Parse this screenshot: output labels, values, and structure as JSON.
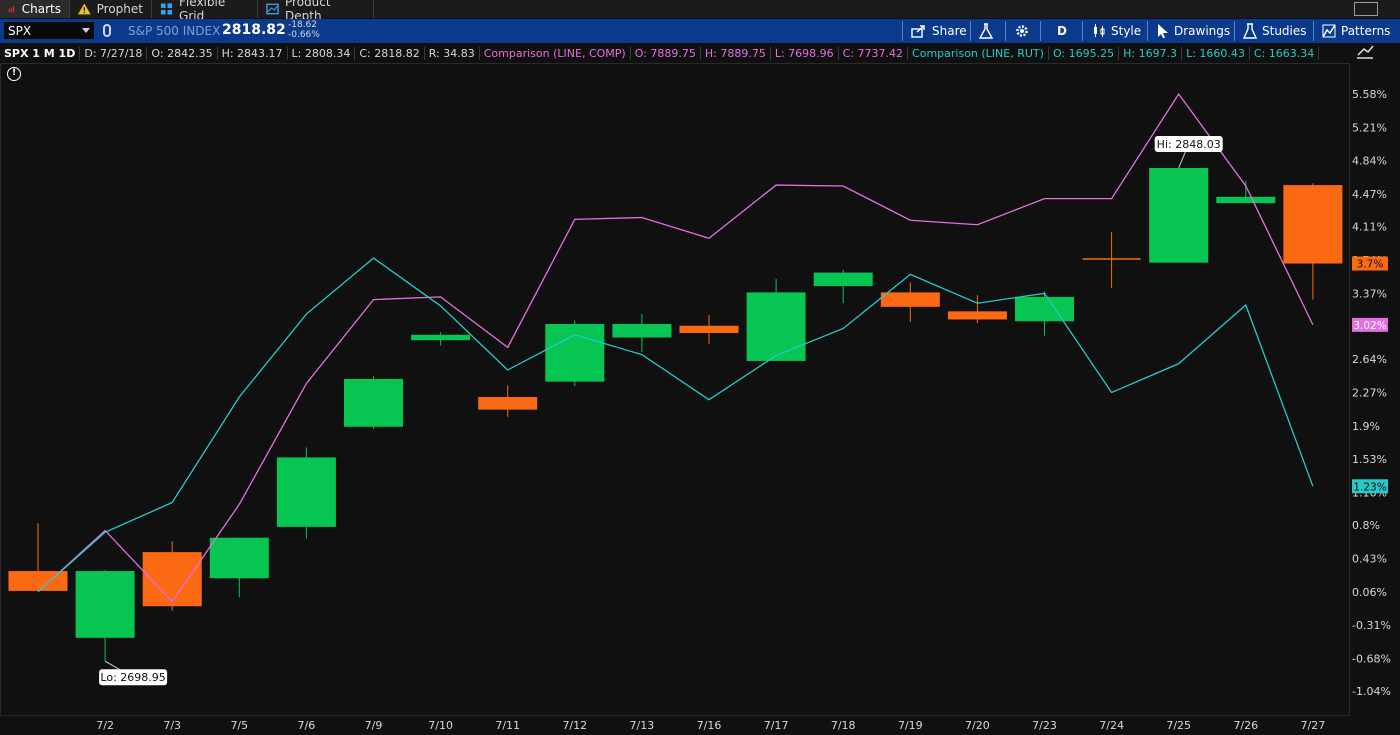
{
  "tabs": [
    {
      "label": "Charts",
      "icon": "bar-chart-icon"
    },
    {
      "label": "Prophet",
      "icon": "warning-triangle-icon"
    },
    {
      "label": "Flexible Grid",
      "icon": "grid-icon"
    },
    {
      "label": "Product Depth",
      "icon": "depth-chart-icon"
    }
  ],
  "symbol": {
    "ticker": "SPX",
    "name": "S&P 500 INDEX",
    "price": "2818.82",
    "change": "-18.62",
    "change_pct": "-0.66%"
  },
  "toolbar": {
    "share": "Share",
    "aggregation": "D",
    "style": "Style",
    "drawings": "Drawings",
    "studies": "Studies",
    "patterns": "Patterns"
  },
  "infobar": {
    "title": "SPX 1 M 1D",
    "date": "D: 7/27/18",
    "open": "O: 2842.35",
    "high": "H: 2843.17",
    "low": "L: 2808.34",
    "close": "C: 2818.82",
    "range": "R: 34.83",
    "comp_label": "Comparison (LINE, COMP)",
    "comp_open": "O: 7889.75",
    "comp_high": "H: 7889.75",
    "comp_low": "L: 7698.96",
    "comp_close": "C: 7737.42",
    "rut_label": "Comparison (LINE, RUT)",
    "rut_open": "O: 1695.25",
    "rut_high": "H: 1697.3",
    "rut_low": "L: 1660.43",
    "rut_close": "C: 1663.34"
  },
  "chart_data": {
    "type": "candlestick",
    "x_labels": [
      "7/2",
      "7/3",
      "7/5",
      "7/6",
      "7/9",
      "7/10",
      "7/11",
      "7/12",
      "7/13",
      "7/16",
      "7/17",
      "7/18",
      "7/19",
      "7/20",
      "7/23",
      "7/24",
      "7/25",
      "7/26",
      "7/27"
    ],
    "y_axis_percent": [
      "5.58%",
      "5.21%",
      "4.84%",
      "4.47%",
      "4.11%",
      "3.74%",
      "3.37%",
      "3.0%",
      "2.64%",
      "2.27%",
      "1.9%",
      "1.53%",
      "1.16%",
      "0.8%",
      "0.43%",
      "0.06%",
      "-0.31%",
      "-0.68%",
      "-1.04%"
    ],
    "y_range_percent": [
      -1.04,
      5.58
    ],
    "candles_percent": [
      {
        "o": 0.29,
        "h": 0.82,
        "l": 0.07,
        "c": 0.07,
        "up": false
      },
      {
        "o": -0.45,
        "h": 0.3,
        "l": -0.71,
        "c": 0.29,
        "up": true
      },
      {
        "o": 0.5,
        "h": 0.62,
        "l": -0.15,
        "c": -0.1,
        "up": false
      },
      {
        "o": 0.21,
        "h": 0.66,
        "l": 0.0,
        "c": 0.66,
        "up": true
      },
      {
        "o": 0.78,
        "h": 1.66,
        "l": 0.65,
        "c": 1.55,
        "up": true
      },
      {
        "o": 1.89,
        "h": 2.45,
        "l": 1.87,
        "c": 2.42,
        "up": true
      },
      {
        "o": 2.85,
        "h": 2.94,
        "l": 2.79,
        "c": 2.91,
        "up": true
      },
      {
        "o": 2.22,
        "h": 2.35,
        "l": 2.0,
        "c": 2.08,
        "up": false
      },
      {
        "o": 2.39,
        "h": 3.07,
        "l": 2.34,
        "c": 3.03,
        "up": true
      },
      {
        "o": 2.88,
        "h": 3.14,
        "l": 2.72,
        "c": 3.03,
        "up": true
      },
      {
        "o": 3.01,
        "h": 3.13,
        "l": 2.81,
        "c": 2.93,
        "up": false
      },
      {
        "o": 2.62,
        "h": 3.53,
        "l": 2.62,
        "c": 3.38,
        "up": true
      },
      {
        "o": 3.45,
        "h": 3.63,
        "l": 3.26,
        "c": 3.6,
        "up": true
      },
      {
        "o": 3.38,
        "h": 3.49,
        "l": 3.05,
        "c": 3.22,
        "up": false
      },
      {
        "o": 3.17,
        "h": 3.35,
        "l": 3.04,
        "c": 3.08,
        "up": false
      },
      {
        "o": 3.06,
        "h": 3.39,
        "l": 2.9,
        "c": 3.33,
        "up": true
      },
      {
        "o": 3.75,
        "h": 4.05,
        "l": 3.43,
        "c": 3.75,
        "up": false
      },
      {
        "o": 3.71,
        "h": 4.76,
        "l": 3.71,
        "c": 4.76,
        "up": true
      },
      {
        "o": 4.37,
        "h": 4.62,
        "l": 4.37,
        "c": 4.44,
        "up": true
      },
      {
        "o": 4.57,
        "h": 4.59,
        "l": 3.3,
        "c": 3.7,
        "up": false
      }
    ],
    "series": [
      {
        "name": "Comparison (LINE, COMP)",
        "color": "#e46fe0",
        "values": [
          0.06,
          0.74,
          -0.05,
          1.03,
          2.37,
          3.3,
          3.33,
          2.77,
          4.19,
          4.21,
          3.98,
          4.57,
          4.56,
          4.18,
          4.13,
          4.42,
          4.42,
          5.58,
          4.56,
          3.02
        ]
      },
      {
        "name": "Comparison (LINE, RUT)",
        "color": "#29c9c9",
        "values": [
          0.06,
          0.72,
          1.05,
          2.22,
          3.14,
          3.76,
          3.23,
          2.52,
          2.91,
          2.69,
          2.19,
          2.68,
          2.98,
          3.58,
          3.26,
          3.37,
          2.27,
          2.59,
          3.24,
          1.23
        ]
      }
    ],
    "labels": {
      "hi": "Hi: 2848.03",
      "lo": "Lo: 2698.95",
      "price_tag": "3.7%",
      "comp_tag": "3.02%",
      "rut_tag": "1.23%"
    },
    "colors": {
      "up": "#06c553",
      "down": "#fb6a12",
      "background": "#101010",
      "axis_text": "#d8d8d8"
    }
  }
}
